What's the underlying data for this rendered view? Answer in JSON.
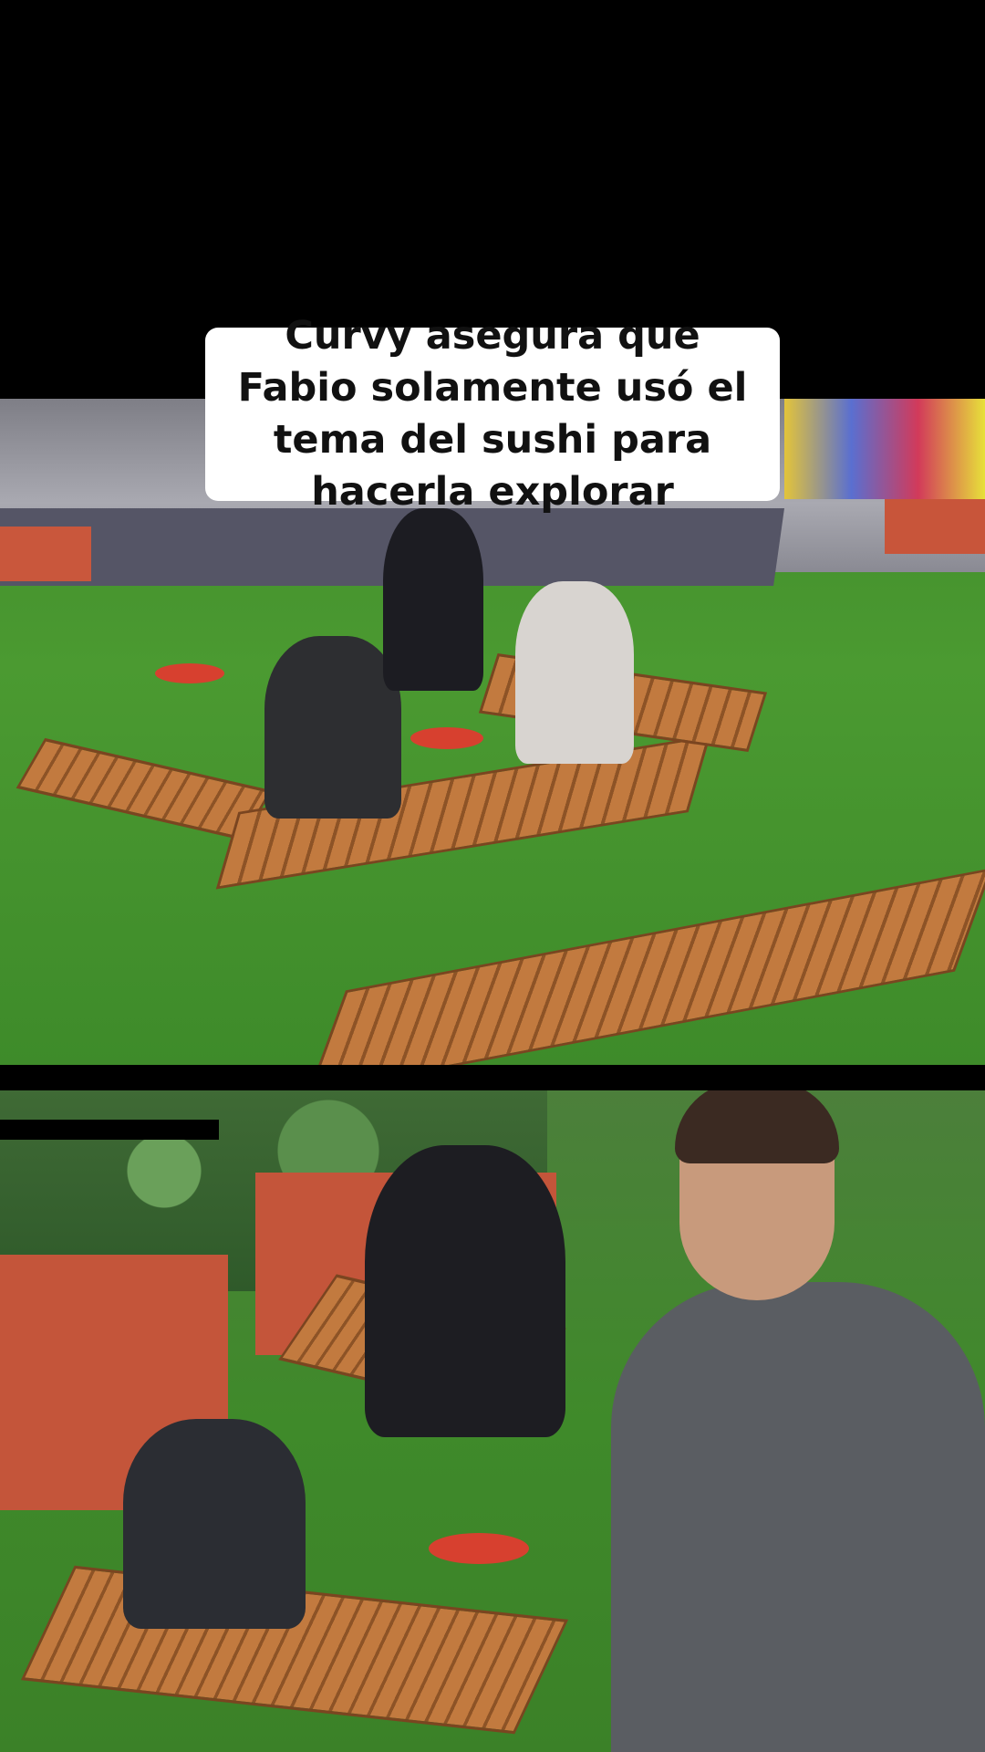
{
  "caption": {
    "text": "Curvy asegura que Fabio solamente usó el tema del sushi para hacerla explorar"
  },
  "colors": {
    "background": "#000000",
    "caption_bg": "#ffffff",
    "caption_text": "#111111",
    "grass": "#4b9a31",
    "wood": "#c27a3f",
    "planter": "#c8553a"
  },
  "scenes": {
    "top": "outdoor-garden-scene",
    "bottom": "outdoor-garden-scene-with-presenter"
  }
}
